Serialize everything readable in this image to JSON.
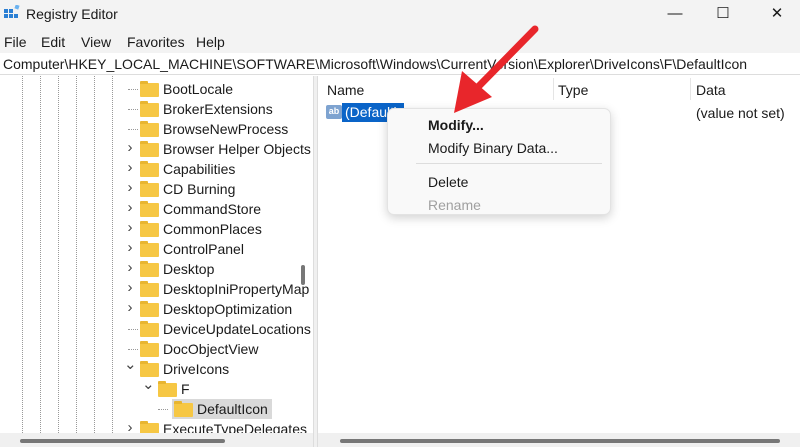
{
  "window": {
    "title": "Registry Editor",
    "minimize": "—",
    "maximize": "☐",
    "close": "✕"
  },
  "menu": [
    "File",
    "Edit",
    "View",
    "Favorites",
    "Help"
  ],
  "address": "Computer\\HKEY_LOCAL_MACHINE\\SOFTWARE\\Microsoft\\Windows\\CurrentVersion\\Explorer\\DriveIcons\\F\\DefaultIcon",
  "tree": [
    {
      "label": "BootLocale",
      "chevron": ""
    },
    {
      "label": "BrokerExtensions",
      "chevron": ""
    },
    {
      "label": "BrowseNewProcess",
      "chevron": ""
    },
    {
      "label": "Browser Helper Objects",
      "chevron": "right"
    },
    {
      "label": "Capabilities",
      "chevron": "right"
    },
    {
      "label": "CD Burning",
      "chevron": "right"
    },
    {
      "label": "CommandStore",
      "chevron": "right"
    },
    {
      "label": "CommonPlaces",
      "chevron": "right"
    },
    {
      "label": "ControlPanel",
      "chevron": "right"
    },
    {
      "label": "Desktop",
      "chevron": "right"
    },
    {
      "label": "DesktopIniPropertyMap",
      "chevron": "right"
    },
    {
      "label": "DesktopOptimization",
      "chevron": "right"
    },
    {
      "label": "DeviceUpdateLocations",
      "chevron": ""
    },
    {
      "label": "DocObjectView",
      "chevron": ""
    },
    {
      "label": "DriveIcons",
      "chevron": "down"
    },
    {
      "label": "F",
      "chevron": "down",
      "level": 1
    },
    {
      "label": "DefaultIcon",
      "chevron": "",
      "level": 2,
      "selected": true
    },
    {
      "label": "ExecuteTypeDelegates",
      "chevron": "right"
    }
  ],
  "list": {
    "columns": [
      "Name",
      "Type",
      "Data"
    ],
    "rows": [
      {
        "icon": "ab",
        "name": "(Default)",
        "type": "",
        "data": "(value not set)"
      }
    ]
  },
  "context_menu": {
    "items": [
      "Modify...",
      "Modify Binary Data...",
      "Delete",
      "Rename"
    ],
    "disabled": [
      "Rename"
    ],
    "default": "Modify..."
  },
  "colors": {
    "accent": "#0a64c8",
    "arrow": "#e8262b",
    "folder": "#f6c744"
  }
}
